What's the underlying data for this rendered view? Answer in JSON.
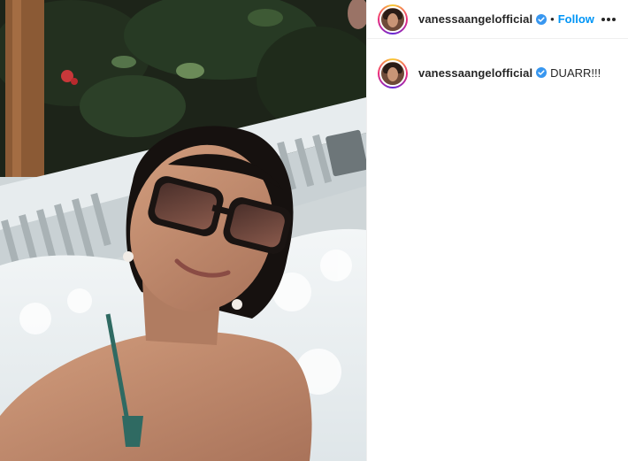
{
  "post": {
    "author": {
      "username": "vanessaangelofficial",
      "verified": true,
      "verified_icon": "verified-badge-icon",
      "avatar_icon": "profile-avatar"
    },
    "header": {
      "separator": "•",
      "follow_label": "Follow",
      "more_icon": "more-options-icon"
    },
    "caption": {
      "username": "vanessaangelofficial",
      "text": "DUARR!!!"
    },
    "photo": {
      "description_icon": "post-photo"
    }
  },
  "colors": {
    "link_blue": "#0095f6",
    "verified_blue": "#3897f0",
    "text": "#262626",
    "divider": "#efefef"
  }
}
